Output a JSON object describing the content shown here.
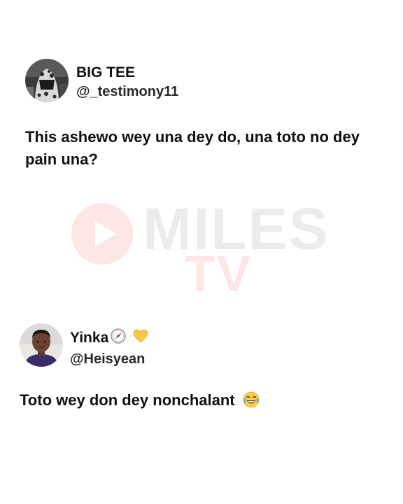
{
  "posts": [
    {
      "display_name": "BIG TEE",
      "handle": "@_testimony11",
      "text": "This ashewo wey una dey do, una toto no dey pain una?",
      "avatar_icon": "masked-figure-avatar"
    },
    {
      "display_name": "Yinka",
      "handle": "@Heisyean",
      "text": "Toto wey don dey nonchalant",
      "name_icons": [
        "compass-icon",
        "yellow-heart-icon"
      ],
      "text_emoji": "face-with-tears-of-joy-icon",
      "avatar_icon": "person-avatar"
    }
  ],
  "watermark": {
    "word": "MILES",
    "sub": "TV",
    "icon": "play-button-icon",
    "colors": {
      "red": "#e8453c",
      "gray": "#6b6b6b"
    }
  }
}
